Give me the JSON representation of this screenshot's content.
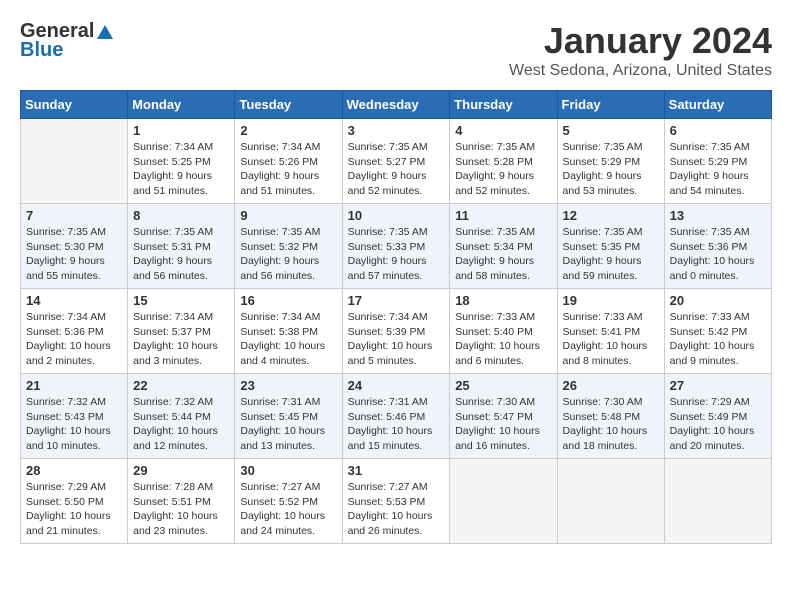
{
  "header": {
    "logo_general": "General",
    "logo_blue": "Blue",
    "month_year": "January 2024",
    "location": "West Sedona, Arizona, United States"
  },
  "days_of_week": [
    "Sunday",
    "Monday",
    "Tuesday",
    "Wednesday",
    "Thursday",
    "Friday",
    "Saturday"
  ],
  "weeks": [
    [
      {
        "day": "",
        "sunrise": "",
        "sunset": "",
        "daylight": "",
        "empty": true
      },
      {
        "day": "1",
        "sunrise": "Sunrise: 7:34 AM",
        "sunset": "Sunset: 5:25 PM",
        "daylight": "Daylight: 9 hours and 51 minutes."
      },
      {
        "day": "2",
        "sunrise": "Sunrise: 7:34 AM",
        "sunset": "Sunset: 5:26 PM",
        "daylight": "Daylight: 9 hours and 51 minutes."
      },
      {
        "day": "3",
        "sunrise": "Sunrise: 7:35 AM",
        "sunset": "Sunset: 5:27 PM",
        "daylight": "Daylight: 9 hours and 52 minutes."
      },
      {
        "day": "4",
        "sunrise": "Sunrise: 7:35 AM",
        "sunset": "Sunset: 5:28 PM",
        "daylight": "Daylight: 9 hours and 52 minutes."
      },
      {
        "day": "5",
        "sunrise": "Sunrise: 7:35 AM",
        "sunset": "Sunset: 5:29 PM",
        "daylight": "Daylight: 9 hours and 53 minutes."
      },
      {
        "day": "6",
        "sunrise": "Sunrise: 7:35 AM",
        "sunset": "Sunset: 5:29 PM",
        "daylight": "Daylight: 9 hours and 54 minutes."
      }
    ],
    [
      {
        "day": "7",
        "sunrise": "Sunrise: 7:35 AM",
        "sunset": "Sunset: 5:30 PM",
        "daylight": "Daylight: 9 hours and 55 minutes."
      },
      {
        "day": "8",
        "sunrise": "Sunrise: 7:35 AM",
        "sunset": "Sunset: 5:31 PM",
        "daylight": "Daylight: 9 hours and 56 minutes."
      },
      {
        "day": "9",
        "sunrise": "Sunrise: 7:35 AM",
        "sunset": "Sunset: 5:32 PM",
        "daylight": "Daylight: 9 hours and 56 minutes."
      },
      {
        "day": "10",
        "sunrise": "Sunrise: 7:35 AM",
        "sunset": "Sunset: 5:33 PM",
        "daylight": "Daylight: 9 hours and 57 minutes."
      },
      {
        "day": "11",
        "sunrise": "Sunrise: 7:35 AM",
        "sunset": "Sunset: 5:34 PM",
        "daylight": "Daylight: 9 hours and 58 minutes."
      },
      {
        "day": "12",
        "sunrise": "Sunrise: 7:35 AM",
        "sunset": "Sunset: 5:35 PM",
        "daylight": "Daylight: 9 hours and 59 minutes."
      },
      {
        "day": "13",
        "sunrise": "Sunrise: 7:35 AM",
        "sunset": "Sunset: 5:36 PM",
        "daylight": "Daylight: 10 hours and 0 minutes."
      }
    ],
    [
      {
        "day": "14",
        "sunrise": "Sunrise: 7:34 AM",
        "sunset": "Sunset: 5:36 PM",
        "daylight": "Daylight: 10 hours and 2 minutes."
      },
      {
        "day": "15",
        "sunrise": "Sunrise: 7:34 AM",
        "sunset": "Sunset: 5:37 PM",
        "daylight": "Daylight: 10 hours and 3 minutes."
      },
      {
        "day": "16",
        "sunrise": "Sunrise: 7:34 AM",
        "sunset": "Sunset: 5:38 PM",
        "daylight": "Daylight: 10 hours and 4 minutes."
      },
      {
        "day": "17",
        "sunrise": "Sunrise: 7:34 AM",
        "sunset": "Sunset: 5:39 PM",
        "daylight": "Daylight: 10 hours and 5 minutes."
      },
      {
        "day": "18",
        "sunrise": "Sunrise: 7:33 AM",
        "sunset": "Sunset: 5:40 PM",
        "daylight": "Daylight: 10 hours and 6 minutes."
      },
      {
        "day": "19",
        "sunrise": "Sunrise: 7:33 AM",
        "sunset": "Sunset: 5:41 PM",
        "daylight": "Daylight: 10 hours and 8 minutes."
      },
      {
        "day": "20",
        "sunrise": "Sunrise: 7:33 AM",
        "sunset": "Sunset: 5:42 PM",
        "daylight": "Daylight: 10 hours and 9 minutes."
      }
    ],
    [
      {
        "day": "21",
        "sunrise": "Sunrise: 7:32 AM",
        "sunset": "Sunset: 5:43 PM",
        "daylight": "Daylight: 10 hours and 10 minutes."
      },
      {
        "day": "22",
        "sunrise": "Sunrise: 7:32 AM",
        "sunset": "Sunset: 5:44 PM",
        "daylight": "Daylight: 10 hours and 12 minutes."
      },
      {
        "day": "23",
        "sunrise": "Sunrise: 7:31 AM",
        "sunset": "Sunset: 5:45 PM",
        "daylight": "Daylight: 10 hours and 13 minutes."
      },
      {
        "day": "24",
        "sunrise": "Sunrise: 7:31 AM",
        "sunset": "Sunset: 5:46 PM",
        "daylight": "Daylight: 10 hours and 15 minutes."
      },
      {
        "day": "25",
        "sunrise": "Sunrise: 7:30 AM",
        "sunset": "Sunset: 5:47 PM",
        "daylight": "Daylight: 10 hours and 16 minutes."
      },
      {
        "day": "26",
        "sunrise": "Sunrise: 7:30 AM",
        "sunset": "Sunset: 5:48 PM",
        "daylight": "Daylight: 10 hours and 18 minutes."
      },
      {
        "day": "27",
        "sunrise": "Sunrise: 7:29 AM",
        "sunset": "Sunset: 5:49 PM",
        "daylight": "Daylight: 10 hours and 20 minutes."
      }
    ],
    [
      {
        "day": "28",
        "sunrise": "Sunrise: 7:29 AM",
        "sunset": "Sunset: 5:50 PM",
        "daylight": "Daylight: 10 hours and 21 minutes."
      },
      {
        "day": "29",
        "sunrise": "Sunrise: 7:28 AM",
        "sunset": "Sunset: 5:51 PM",
        "daylight": "Daylight: 10 hours and 23 minutes."
      },
      {
        "day": "30",
        "sunrise": "Sunrise: 7:27 AM",
        "sunset": "Sunset: 5:52 PM",
        "daylight": "Daylight: 10 hours and 24 minutes."
      },
      {
        "day": "31",
        "sunrise": "Sunrise: 7:27 AM",
        "sunset": "Sunset: 5:53 PM",
        "daylight": "Daylight: 10 hours and 26 minutes."
      },
      {
        "day": "",
        "sunrise": "",
        "sunset": "",
        "daylight": "",
        "empty": true
      },
      {
        "day": "",
        "sunrise": "",
        "sunset": "",
        "daylight": "",
        "empty": true
      },
      {
        "day": "",
        "sunrise": "",
        "sunset": "",
        "daylight": "",
        "empty": true
      }
    ]
  ]
}
